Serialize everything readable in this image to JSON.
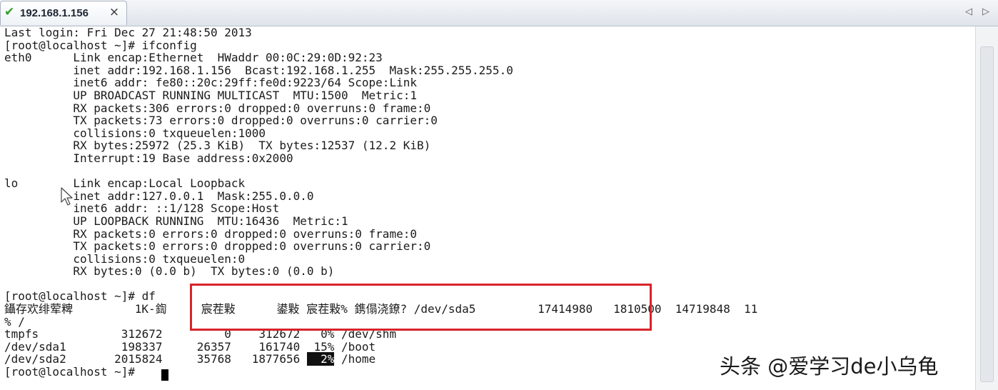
{
  "tab": {
    "title": "192.168.1.156",
    "status_icon": "check-icon",
    "close_glyph": "×"
  },
  "nav": {
    "prev_glyph": "◁",
    "next_glyph": "▷"
  },
  "terminal": {
    "lines": [
      "Last login: Fri Dec 27 21:48:50 2013",
      "[root@localhost ~]# ifconfig",
      "eth0      Link encap:Ethernet  HWaddr 00:0C:29:0D:92:23",
      "          inet addr:192.168.1.156  Bcast:192.168.1.255  Mask:255.255.255.0",
      "          inet6 addr: fe80::20c:29ff:fe0d:9223/64 Scope:Link",
      "          UP BROADCAST RUNNING MULTICAST  MTU:1500  Metric:1",
      "          RX packets:306 errors:0 dropped:0 overruns:0 frame:0",
      "          TX packets:73 errors:0 dropped:0 overruns:0 carrier:0",
      "          collisions:0 txqueuelen:1000",
      "          RX bytes:25972 (25.3 KiB)  TX bytes:12537 (12.2 KiB)",
      "          Interrupt:19 Base address:0x2000",
      "",
      "lo        Link encap:Local Loopback",
      "          inet addr:127.0.0.1  Mask:255.0.0.0",
      "          inet6 addr: ::1/128 Scope:Host",
      "          UP LOOPBACK RUNNING  MTU:16436  Metric:1",
      "          RX packets:0 errors:0 dropped:0 overruns:0 frame:0",
      "          TX packets:0 errors:0 dropped:0 overruns:0 carrier:0",
      "          collisions:0 txqueuelen:0",
      "          RX bytes:0 (0.0 b)  TX bytes:0 (0.0 b)",
      "",
      "[root@localhost ~]# df",
      "鑷存欢绯荤粺         1K-鍧     宸茬敤      鍙敤 宸茬敤% 鎸傝浇鐐? /dev/sda5         17414980   1810500  14719848  11",
      "% /",
      "tmpfs            312672         0    312672   0% /dev/shm",
      "/dev/sda1        198337     26357    161740  15% /boot",
      "/dev/sda2       2015824     35768   1877656 "
    ],
    "last_line_highlight": "  2%",
    "last_line_tail": " /home",
    "prompt": "[root@localhost ~]# "
  },
  "watermark": "头条 @爱学习de小乌龟"
}
